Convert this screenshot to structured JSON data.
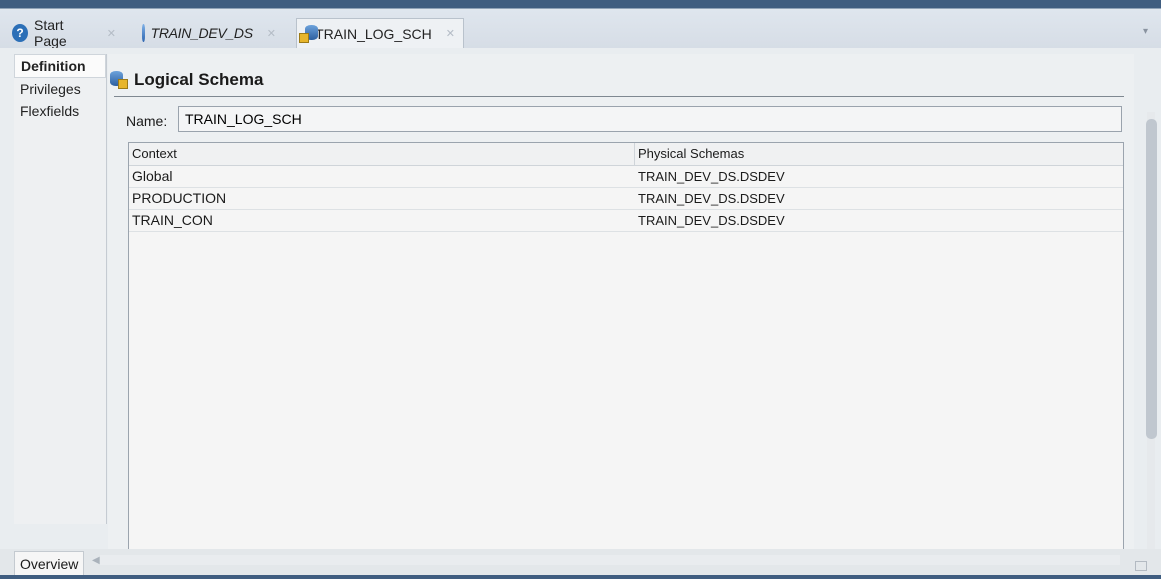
{
  "tabs": [
    {
      "label": "Start Page",
      "icon": "help-icon",
      "italic": false,
      "active": false
    },
    {
      "label": "TRAIN_DEV_DS",
      "icon": "data-server-icon",
      "italic": true,
      "active": false
    },
    {
      "label": "TRAIN_LOG_SCH",
      "icon": "logical-schema-icon",
      "italic": false,
      "active": true
    }
  ],
  "sidenav": {
    "items": [
      {
        "label": "Definition",
        "active": true
      },
      {
        "label": "Privileges",
        "active": false
      },
      {
        "label": "Flexfields",
        "active": false
      }
    ]
  },
  "section": {
    "title": "Logical Schema"
  },
  "name_field": {
    "label": "Name:",
    "value": "TRAIN_LOG_SCH"
  },
  "table": {
    "columns": [
      "Context",
      "Physical Schemas"
    ],
    "rows": [
      [
        "Global",
        "TRAIN_DEV_DS.DSDEV"
      ],
      [
        "PRODUCTION",
        "TRAIN_DEV_DS.DSDEV"
      ],
      [
        "TRAIN_CON",
        "TRAIN_DEV_DS.DSDEV"
      ]
    ]
  },
  "bottom": {
    "overview_label": "Overview"
  },
  "colors": {
    "accent": "#3f5d80",
    "active_tab_bg": "#eef1f4",
    "panel_bg": "#edf0f2"
  }
}
